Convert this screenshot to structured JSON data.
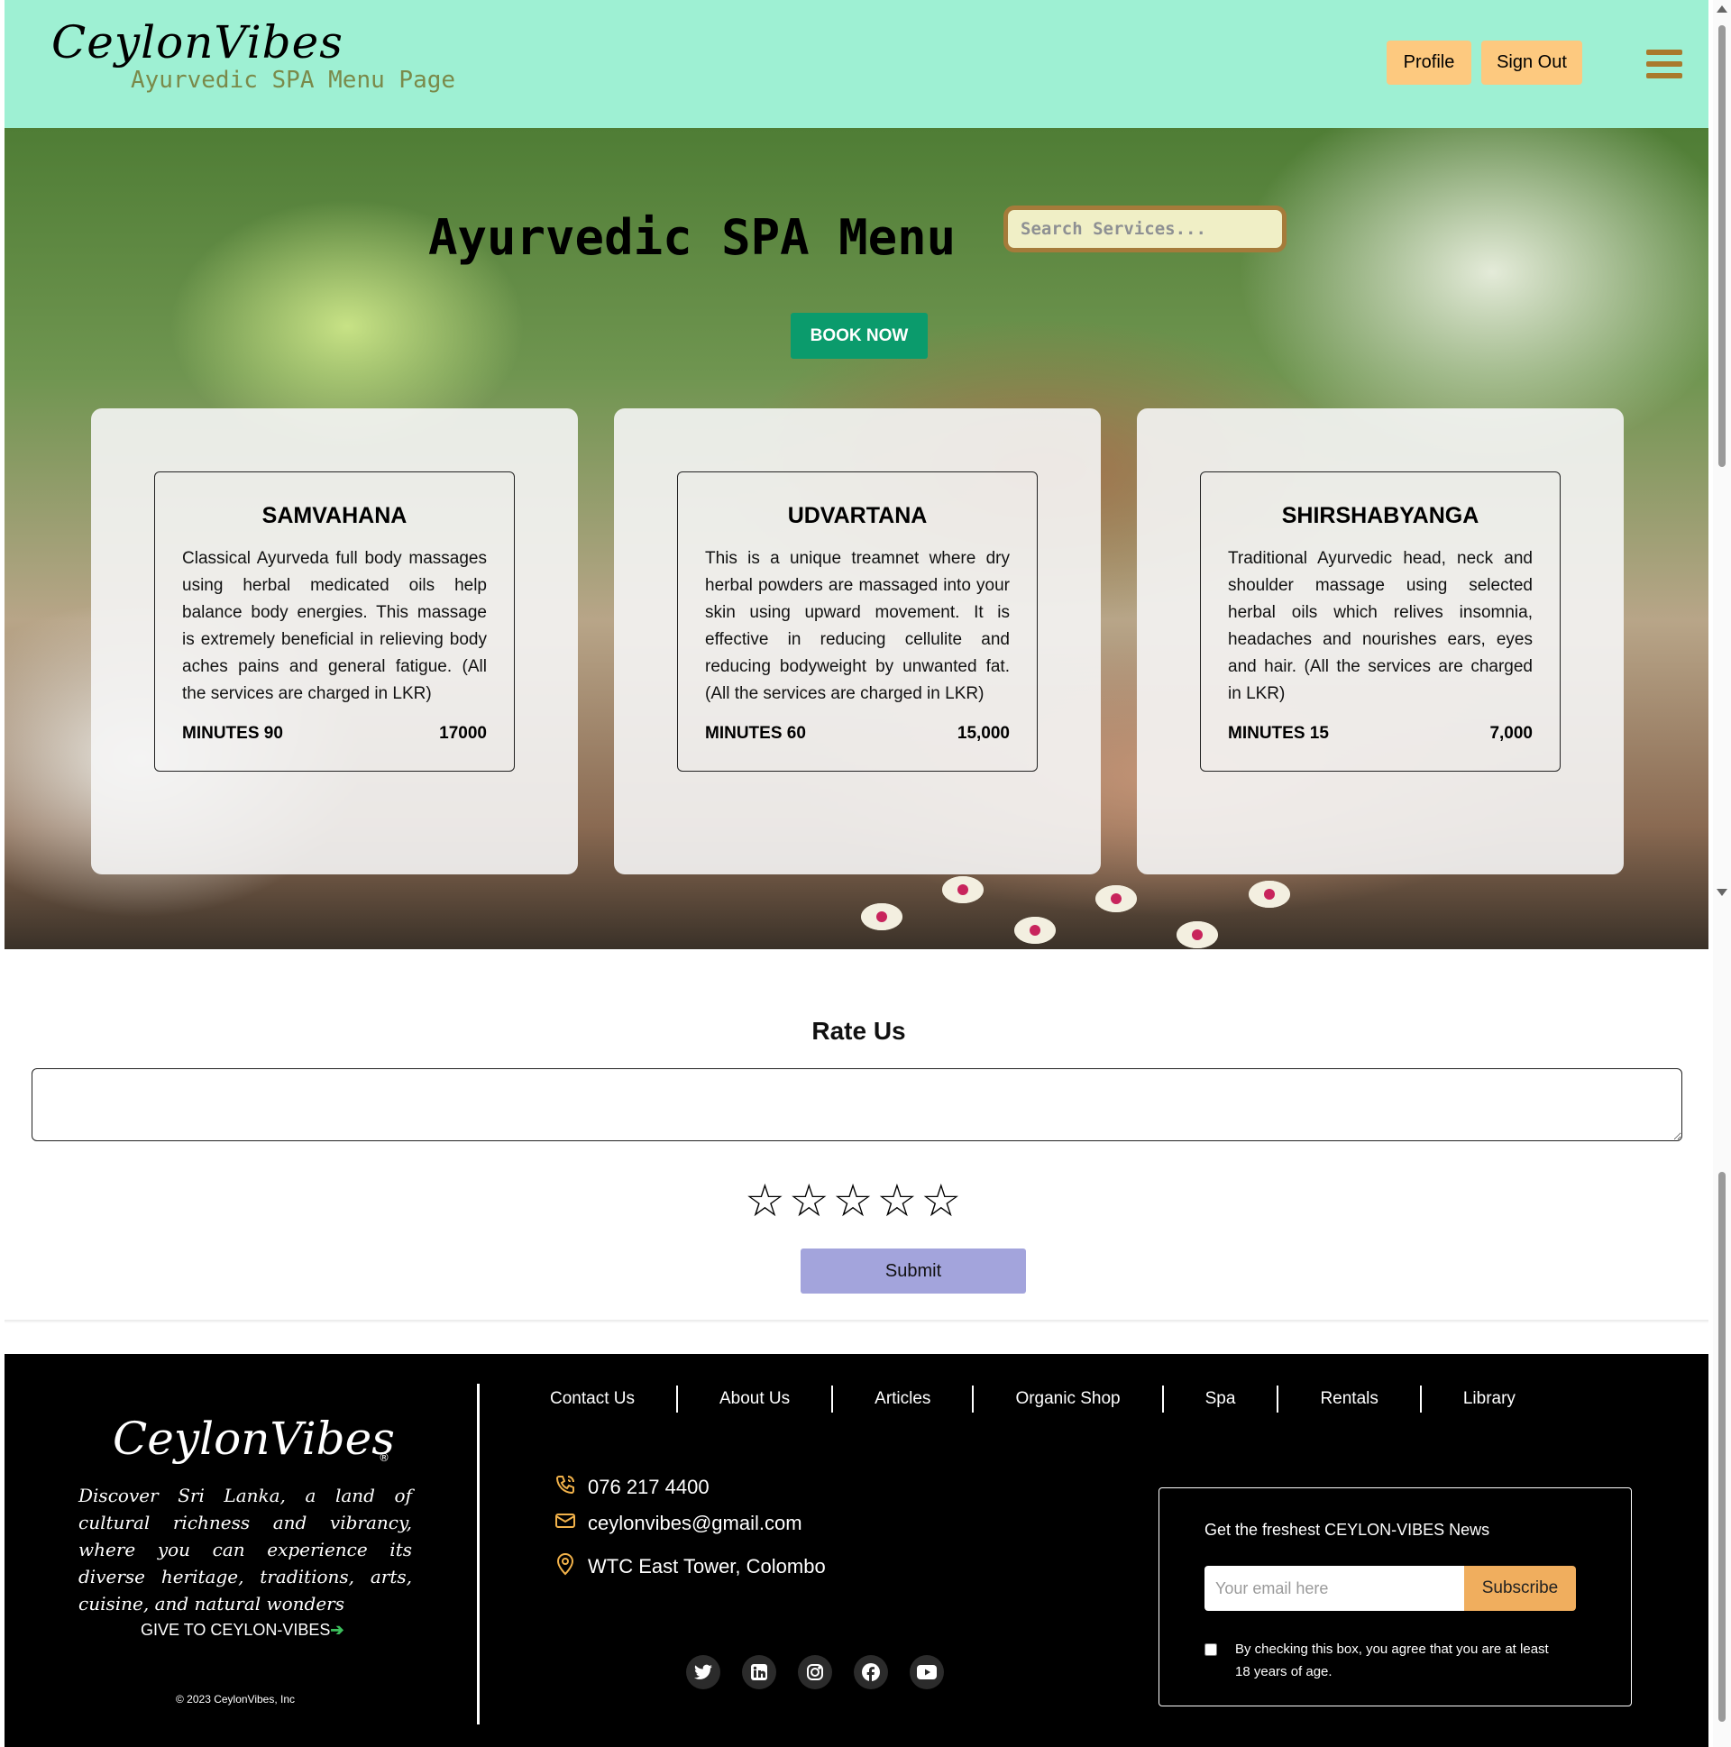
{
  "header": {
    "logo": "CeylonVibes",
    "subtitle": "Ayurvedic SPA Menu Page",
    "profile_label": "Profile",
    "signout_label": "Sign Out"
  },
  "hero": {
    "title": "Ayurvedic SPA Menu",
    "search_placeholder": "Search Services...",
    "book_label": "BOOK NOW"
  },
  "services": [
    {
      "name": "SAMVAHANA",
      "description": "Classical Ayurveda full body massages using herbal medicated oils help balance body energies. This massage is extremely beneficial in relieving body aches pains and general fatigue. (All the services are charged in LKR)",
      "minutes": "MINUTES 90",
      "price": "17000"
    },
    {
      "name": "UDVARTANA",
      "description": "This is a unique treamnet where dry herbal powders are massaged into your skin using upward movement. It is effective in reducing cellulite and reducing bodyweight by unwanted fat. (All the services are charged in LKR)",
      "minutes": "MINUTES 60",
      "price": "15,000"
    },
    {
      "name": "SHIRSHABYANGA",
      "description": "Traditional Ayurvedic head, neck and shoulder massage using selected herbal oils which relives insomnia, headaches and nourishes ears, eyes and hair. (All the services are charged in LKR)",
      "minutes": "MINUTES 15",
      "price": "7,000"
    }
  ],
  "rate": {
    "title": "Rate Us",
    "textarea_value": "",
    "stars": [
      "☆",
      "☆",
      "☆",
      "☆",
      "☆"
    ],
    "submit_label": "Submit"
  },
  "footer": {
    "logo": "CeylonVibes",
    "registered": "®",
    "tagline": "Discover Sri Lanka, a land of cultural richness and vibrancy, where you can experience its diverse heritage, traditions, arts, cuisine, and natural wonders",
    "give_label": "GIVE TO CEYLON-VIBES",
    "give_arrow": "➔",
    "copyright": "© 2023 CeylonVibes, Inc",
    "nav": [
      "Contact Us",
      "About Us",
      "Articles",
      "Organic Shop",
      "Spa",
      "Rentals",
      "Library"
    ],
    "contact": {
      "phone": "076 217 4400",
      "email": "ceylonvibes@gmail.com",
      "address": "WTC East Tower, Colombo"
    },
    "icons": {
      "phone": "phone-icon",
      "email": "mail-icon",
      "address": "location-pin-icon"
    },
    "socials": [
      "twitter-icon",
      "linkedin-icon",
      "instagram-icon",
      "facebook-icon",
      "youtube-icon"
    ],
    "newsletter": {
      "title": "Get the freshest CEYLON-VIBES News",
      "email_placeholder": "Your email here",
      "subscribe_label": "Subscribe",
      "consent": "By checking this box, you agree that you are at least 18 years of age."
    }
  },
  "colors": {
    "header_bg": "#9ef0d3",
    "header_button": "#fdc97f",
    "book_button": "#0b9b6c",
    "submit_button": "#a3a4dc",
    "subscribe_button": "#f0ae5e",
    "footer_bg": "#000000"
  }
}
